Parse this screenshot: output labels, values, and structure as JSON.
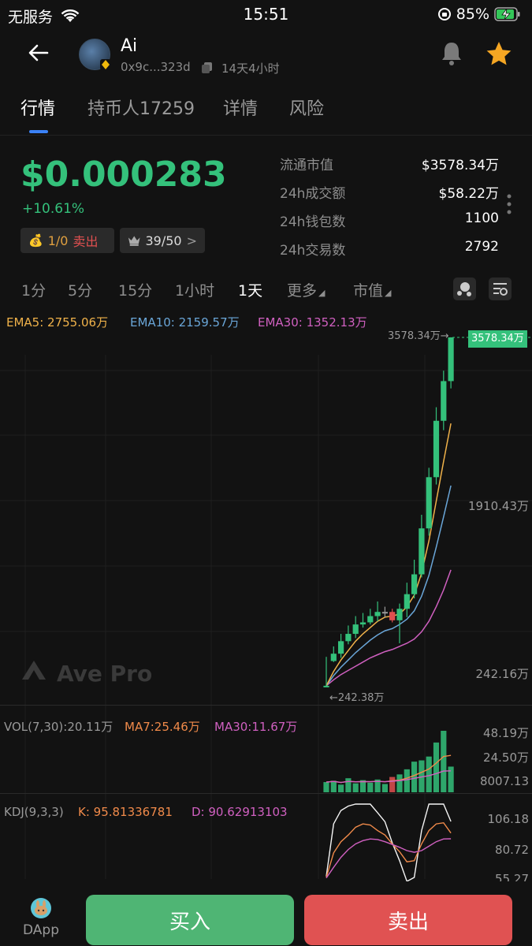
{
  "status": {
    "carrier": "无服务",
    "time": "15:51",
    "battery": "85%"
  },
  "header": {
    "back": "←",
    "name": "Ai",
    "address": "0x9c...323d",
    "age": "14天4小时"
  },
  "tabs": [
    "行情",
    "持币人17259",
    "详情",
    "风险"
  ],
  "price": {
    "value": "$0.000283",
    "change": "+10.61%"
  },
  "chips": {
    "tx_count": "1/0",
    "tx_label": "卖出",
    "holders_rank": "39/50",
    "rank_arrow": ">"
  },
  "stats": [
    {
      "label": "流通市值",
      "value": "$3578.34万"
    },
    {
      "label": "24h成交额",
      "value": "$58.22万"
    },
    {
      "label": "24h钱包数",
      "value": "1100"
    },
    {
      "label": "24h交易数",
      "value": "2792"
    }
  ],
  "timeframes": [
    "1分",
    "5分",
    "15分",
    "1小时",
    "1天",
    "更多",
    "市值"
  ],
  "active_timeframe": "1天",
  "ema": {
    "ema5": "EMA5: 2755.06万",
    "ema10": "EMA10: 2159.57万",
    "ema30": "EMA30: 1352.13万"
  },
  "main_axis": {
    "top": "3578.34万",
    "mid": "1910.43万",
    "bottom": "242.16万",
    "high_marker": "3578.34万→",
    "low_marker": "←242.38万",
    "last_price": "3578.34万"
  },
  "watermark": "Ave Pro",
  "vol": {
    "label": "VOL(7,30):20.11万",
    "ma7": "MA7:25.46万",
    "ma30": "MA30:11.67万",
    "axis": [
      "48.19万",
      "24.50万",
      "8007.13"
    ]
  },
  "kdj": {
    "label": "KDJ(9,3,3)",
    "k": "K: 95.81336781",
    "d": "D: 90.62913103",
    "axis": [
      "106.18",
      "80.72",
      "55.27"
    ]
  },
  "footer": {
    "dapp": "DApp",
    "buy": "买入",
    "sell": "卖出"
  },
  "colors": {
    "up": "#34c17b",
    "down": "#e05050",
    "ema5": "#f0b24a",
    "ema10": "#6aa6d8",
    "ema30": "#d060c0",
    "accent": "#3b82f6"
  },
  "chart_data": {
    "type": "candlestick",
    "title": "",
    "ylim": [
      2421600,
      35783400
    ],
    "candles": [
      [
        2424000,
        2430000,
        5200000,
        2421600
      ],
      [
        4800000,
        5500000,
        6200000,
        4700000
      ],
      [
        5500000,
        6700000,
        7400000,
        5100000
      ],
      [
        6700000,
        7400000,
        8200000,
        6400000
      ],
      [
        7400000,
        8300000,
        9100000,
        7000000
      ],
      [
        8300000,
        8500000,
        9400000,
        8000000
      ],
      [
        8500000,
        9100000,
        9800000,
        8300000
      ],
      [
        9100000,
        9500000,
        10500000,
        8600000
      ],
      [
        9500000,
        9500000,
        10000000,
        9000000
      ],
      [
        9500000,
        8700000,
        9800000,
        8500000
      ],
      [
        8700000,
        9800000,
        10300000,
        6500000
      ],
      [
        9800000,
        11200000,
        12300000,
        9000000
      ],
      [
        11200000,
        13100000,
        14500000,
        10800000
      ],
      [
        13100000,
        17500000,
        18800000,
        12800000
      ],
      [
        17500000,
        22400000,
        23300000,
        16800000
      ],
      [
        22400000,
        27800000,
        29100000,
        21700000
      ],
      [
        27800000,
        31600000,
        32600000,
        26900000
      ],
      [
        31600000,
        35783400,
        35800000,
        30900000
      ]
    ],
    "ema5": [
      2430000,
      3800000,
      4900000,
      5800000,
      6700000,
      7400000,
      8000000,
      8600000,
      9000000,
      9100000,
      9300000,
      10000000,
      11100000,
      13200000,
      16300000,
      20100000,
      23900000,
      27550600
    ],
    "ema10": [
      2430000,
      3400000,
      4200000,
      4900000,
      5600000,
      6200000,
      6800000,
      7300000,
      7700000,
      7900000,
      8300000,
      8800000,
      9600000,
      11000000,
      13000000,
      15700000,
      18600000,
      21595700
    ],
    "ema30": [
      2430000,
      3000000,
      3500000,
      3900000,
      4300000,
      4700000,
      5100000,
      5400000,
      5700000,
      5900000,
      6200000,
      6500000,
      6900000,
      7600000,
      8600000,
      10000000,
      11600000,
      13521300
    ],
    "volume": [
      80000,
      90000,
      60000,
      110000,
      70000,
      95000,
      75000,
      100000,
      65000,
      120000,
      140000,
      180000,
      240000,
      250000,
      280000,
      390000,
      481900,
      201100
    ],
    "kdj_k": [
      56,
      78,
      88,
      94,
      101,
      104,
      103,
      98,
      94,
      86,
      79,
      70,
      71,
      86,
      98,
      104,
      105,
      95.81
    ],
    "kdj_d": [
      55.5,
      65,
      74,
      81,
      86,
      89,
      90.5,
      90,
      88,
      85.5,
      83,
      80,
      78.5,
      80,
      84,
      88,
      90.5,
      90.63
    ]
  }
}
